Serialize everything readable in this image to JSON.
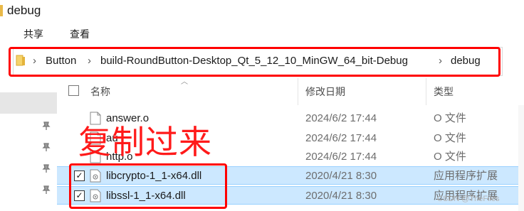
{
  "window": {
    "title": "debug"
  },
  "ribbon": {
    "tabs": [
      "共享",
      "查看"
    ]
  },
  "address": {
    "crumbs": [
      "Button",
      "build-RoundButton-Desktop_Qt_5_12_10_MinGW_64_bit-Debug",
      "debug"
    ],
    "separator": "›"
  },
  "columns": {
    "name": "名称",
    "date": "修改日期",
    "type": "类型"
  },
  "files": [
    {
      "name": "answer.o",
      "date": "2024/6/2 17:44",
      "type": "O 文件",
      "selected": false
    },
    {
      "name": "au",
      "date": "2024/6/2 17:44",
      "type": "O 文件",
      "selected": false
    },
    {
      "name": "http.o",
      "date": "2024/6/2 17:44",
      "type": "O 文件",
      "selected": false
    },
    {
      "name": "libcrypto-1_1-x64.dll",
      "date": "2020/4/21 8:30",
      "type": "应用程序扩展",
      "selected": true
    },
    {
      "name": "libssl-1_1-x64.dll",
      "date": "2020/4/21 8:30",
      "type": "应用程序扩展",
      "selected": true
    }
  ],
  "annotation": {
    "text": "复制过来",
    "color": "#ff1a1a"
  },
  "watermark": "CSDN @TheFiles",
  "colors": {
    "selection": "#cce8ff",
    "highlight": "#ff0000",
    "folder": "#e9b949"
  }
}
